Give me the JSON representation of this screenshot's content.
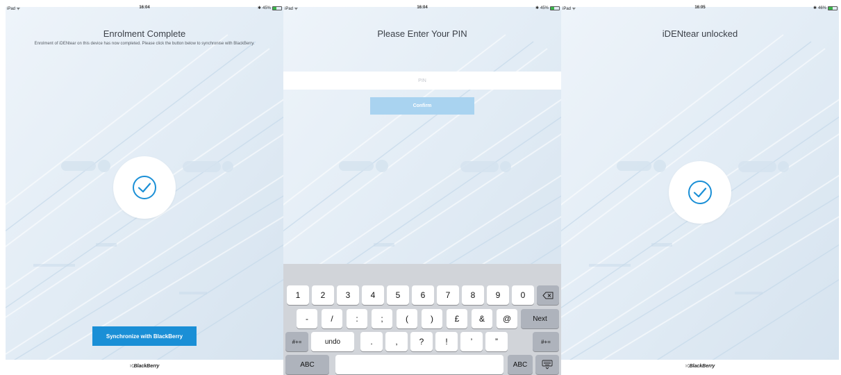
{
  "colors": {
    "accent": "#1a8fd6",
    "confirm_disabled": "#a9d3f0",
    "battery_green": "#3cb44b",
    "keyboard_bg": "#d1d4d9"
  },
  "screen1": {
    "status": {
      "device": "iPad ᯤ",
      "time": "16:04",
      "battery": "45%",
      "battery_level": 0.45
    },
    "title": "Enrolment Complete",
    "message": "Enrolment of iDENtear on this device has now completed. Please click the button below to synchronise with BlackBerry.",
    "check_icon": "checkmark-circle-icon",
    "sync_button": "Synchronize with BlackBerry",
    "footer_logo": "BlackBerry"
  },
  "screen2": {
    "status": {
      "device": "iPad ᯤ",
      "time": "16:04",
      "battery": "45%",
      "battery_level": 0.45
    },
    "title": "Please Enter Your PIN",
    "pin_placeholder": "PIN",
    "confirm_button": "Confirm",
    "keyboard": {
      "row1": [
        "1",
        "2",
        "3",
        "4",
        "5",
        "6",
        "7",
        "8",
        "9",
        "0"
      ],
      "delete_icon": "backspace-icon",
      "row2": [
        "-",
        "/",
        ":",
        ";",
        "(",
        ")",
        "£",
        "&",
        "@"
      ],
      "next": "Next",
      "row3_left": "#+=",
      "undo": "undo",
      "row3": [
        ".",
        ",",
        "?",
        "!",
        "’",
        "”"
      ],
      "row3_right": "#+=",
      "abc_left": "ABC",
      "abc_right": "ABC",
      "hide_keyboard_icon": "keyboard-hide-icon"
    }
  },
  "screen3": {
    "status": {
      "device": "iPad ᯤ",
      "time": "16:05",
      "battery": "46%",
      "battery_level": 0.46
    },
    "title": "iDENtear unlocked",
    "check_icon": "checkmark-circle-icon",
    "footer_logo": "BlackBerry"
  }
}
